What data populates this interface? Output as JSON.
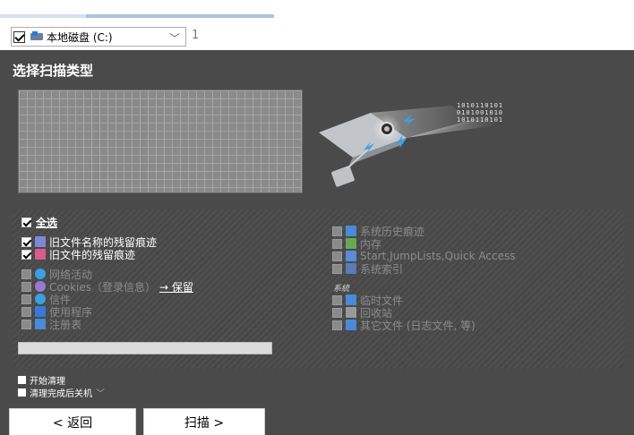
{
  "drive": {
    "label": "本地磁盘 (C:)",
    "count": "1",
    "checked": true
  },
  "panel": {
    "title": "选择扫描类型"
  },
  "binary_art": {
    "lines": [
      "1010110101",
      "0101001010",
      "1010110101"
    ]
  },
  "options": {
    "select_all": "全选",
    "left": [
      {
        "label": "旧文件名称的残留痕迹",
        "checked": true,
        "icon": "list-icon",
        "color": "#7e88d8"
      },
      {
        "label": "旧文件的残留痕迹",
        "checked": true,
        "icon": "file-grid-icon",
        "color": "#d85b8a"
      },
      {
        "label": "网络活动",
        "checked": false,
        "icon": "globe-icon",
        "color": "#3aa0e0"
      },
      {
        "label": "Cookies（登录信息）",
        "checked": false,
        "icon": "cookie-icon",
        "color": "#9a7ad0",
        "link": "→ 保留"
      },
      {
        "label": "信件",
        "checked": false,
        "icon": "mail-icon",
        "color": "#3aa0e0"
      },
      {
        "label": "使用程序",
        "checked": false,
        "icon": "program-icon",
        "color": "#3a78d8"
      },
      {
        "label": "注册表",
        "checked": false,
        "icon": "registry-icon",
        "color": "#4a8ad8"
      }
    ],
    "right": [
      {
        "label": "系统历史痕迹",
        "checked": false,
        "icon": "history-icon",
        "color": "#4a8ad8"
      },
      {
        "label": "内存",
        "checked": false,
        "icon": "memory-icon",
        "color": "#6aa84f"
      },
      {
        "label": "Start,JumpLists,Quick Access",
        "checked": false,
        "icon": "start-icon",
        "color": "#5a8ad8"
      },
      {
        "label": "系统索引",
        "checked": false,
        "icon": "index-icon",
        "color": "#5a7ab8"
      }
    ],
    "system_header": "系統",
    "system": [
      {
        "label": "临时文件",
        "checked": false,
        "icon": "temp-file-icon",
        "color": "#4a8ad8"
      },
      {
        "label": "回收站",
        "checked": false,
        "icon": "recycle-bin-icon",
        "color": "#9a9a9a"
      },
      {
        "label": "其它文件 (日志文件, 等)",
        "checked": false,
        "icon": "other-files-icon",
        "color": "#4a8ad8"
      }
    ]
  },
  "progress": {
    "value": 0
  },
  "bottom": {
    "start_clean": "开始清理",
    "shutdown": "清理完成后关机",
    "shutdown_chevron": "﹀"
  },
  "buttons": {
    "back": "< 返回",
    "scan": "扫描 >"
  }
}
